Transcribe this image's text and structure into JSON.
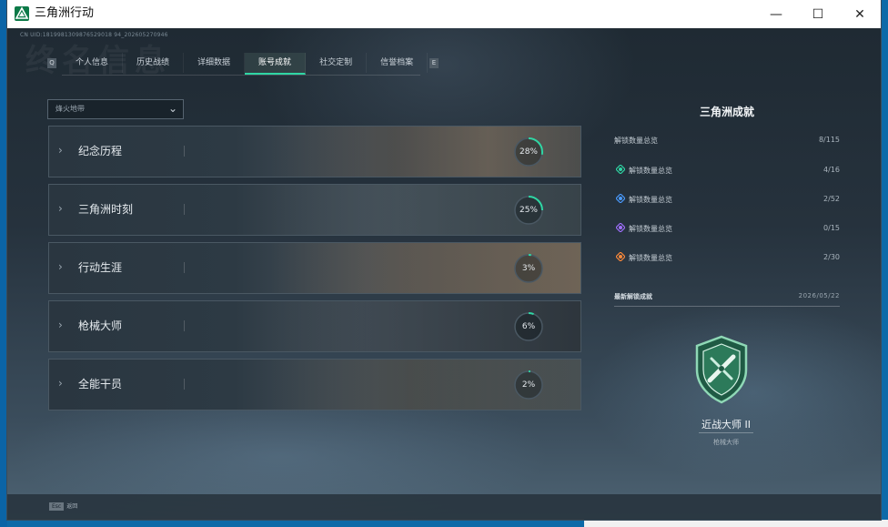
{
  "window": {
    "title": "三角洲行动",
    "minimize_glyph": "—",
    "maximize_glyph": "☐",
    "close_glyph": "✕"
  },
  "header": {
    "uid_line": "CN UID:1819981309876529018 94_202605270946",
    "bg_heading": "终名信息"
  },
  "tabs": {
    "items": [
      "个人信息",
      "历史战绩",
      "详细数据",
      "账号成就",
      "社交定制",
      "信誉档案"
    ],
    "active_index": 3,
    "nav_left": "Q",
    "nav_right": "E"
  },
  "filter": {
    "value": "烽火地带"
  },
  "categories": [
    {
      "label": "纪念历程",
      "progress": 0.28,
      "progress_text": "28%"
    },
    {
      "label": "三角洲时刻",
      "progress": 0.25,
      "progress_text": "25%"
    },
    {
      "label": "行动生涯",
      "progress": 0.03,
      "progress_text": "3%"
    },
    {
      "label": "枪械大师",
      "progress": 0.06,
      "progress_text": "6%"
    },
    {
      "label": "全能干员",
      "progress": 0.02,
      "progress_text": "2%"
    }
  ],
  "panel": {
    "title": "三角洲成就",
    "total": {
      "label": "解锁数量总览",
      "value": "8/115"
    },
    "rows": [
      {
        "label": "解锁数量总览",
        "value": "4/16",
        "icon": "green-rank-icon",
        "color": "#2fd6a4"
      },
      {
        "label": "解锁数量总览",
        "value": "2/52",
        "icon": "blue-rank-icon",
        "color": "#4a9bff"
      },
      {
        "label": "解锁数量总览",
        "value": "0/15",
        "icon": "purple-rank-icon",
        "color": "#a070ff"
      },
      {
        "label": "解锁数量总览",
        "value": "2/30",
        "icon": "orange-rank-icon",
        "color": "#ff8a3a"
      }
    ],
    "latest_label": "最新解锁成就",
    "latest_date": "2026/05/22",
    "badge_name": "近战大师 II",
    "badge_category": "枪械大师"
  },
  "bottom": {
    "key": "Esc",
    "hint": "返回"
  },
  "colors": {
    "accent": "#2fd6a4",
    "progress_track": "#4a5863"
  }
}
